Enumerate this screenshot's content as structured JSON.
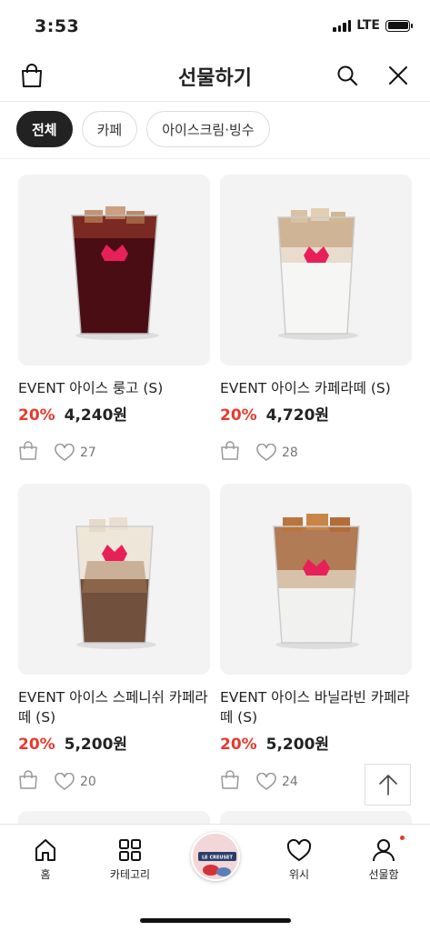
{
  "status_bar": {
    "time": "3:53",
    "network": "LTE"
  },
  "header": {
    "title": "선물하기",
    "left_icon": "shopping-bag-icon",
    "search_icon": "search-icon",
    "close_icon": "close-icon"
  },
  "chips": [
    "전체",
    "카페",
    "아이스크림·빙수"
  ],
  "active_chip": "전체",
  "products": [
    {
      "name": "EVENT 아이스 룽고 (S)",
      "discount": "20%",
      "price": "4,240원",
      "likes": "27",
      "drink": "longo"
    },
    {
      "name": "EVENT 아이스 카페라떼 (S)",
      "discount": "20%",
      "price": "4,720원",
      "likes": "28",
      "drink": "latte"
    },
    {
      "name": "EVENT 아이스 스페니쉬 카페라떼 (S)",
      "discount": "20%",
      "price": "5,200원",
      "likes": "20",
      "drink": "spanish"
    },
    {
      "name": "EVENT 아이스 바닐라빈 카페라떼 (S)",
      "discount": "20%",
      "price": "5,200원",
      "likes": "24",
      "drink": "vanilla"
    }
  ],
  "bottom_nav": {
    "home": "홈",
    "category": "카테고리",
    "wish": "위시",
    "giftbox": "선물함",
    "center_label": "LE CREUSET"
  },
  "colors": {
    "accent": "#e8392e",
    "chip_active": "#222222"
  }
}
